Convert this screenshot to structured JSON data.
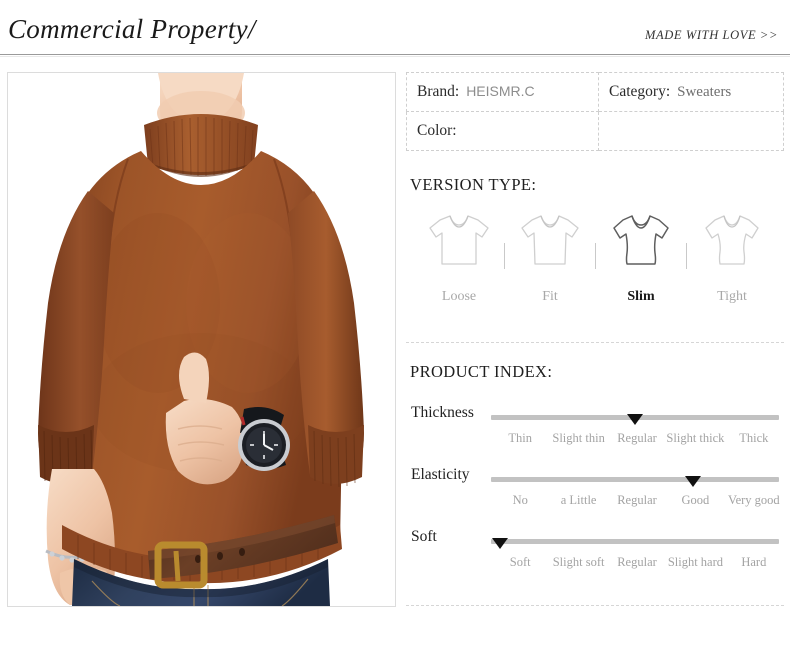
{
  "header": {
    "title": "Commercial Property/",
    "tagline": "MADE WITH LOVE >>"
  },
  "product_image": {
    "alt": "Man wearing brown rust turtleneck sweater with leather belt and blue jeans",
    "sweater_color": "#a0522d",
    "jeans_color": "#2c3e55",
    "belt_color": "#5e3a28",
    "skin_color": "#f3cdb3"
  },
  "attributes": {
    "rows": [
      [
        {
          "key": "Brand:",
          "value": "HEISMR.C",
          "value_style": "sans"
        },
        {
          "key": "Category:",
          "value": "Sweaters",
          "value_style": "serif"
        }
      ],
      [
        {
          "key": "Color:",
          "value": "",
          "value_style": "serif"
        },
        {
          "key": "",
          "value": "",
          "value_style": "serif"
        }
      ]
    ]
  },
  "version_type": {
    "heading": "VERSION TYPE:",
    "options": [
      {
        "label": "Loose",
        "icon": "tee-loose-icon",
        "selected": false
      },
      {
        "label": "Fit",
        "icon": "tee-fit-icon",
        "selected": false
      },
      {
        "label": "Slim",
        "icon": "tee-slim-icon",
        "selected": true
      },
      {
        "label": "Tight",
        "icon": "tee-tight-icon",
        "selected": false
      }
    ]
  },
  "product_index": {
    "heading": "PRODUCT INDEX:",
    "sliders": [
      {
        "name": "Thickness",
        "scale": [
          "Thin",
          "Slight thin",
          "Regular",
          "Slight thick",
          "Thick"
        ],
        "selected_index": 2,
        "selected_value": "Regular",
        "marker_percent": 50
      },
      {
        "name": "Elasticity",
        "scale": [
          "No",
          "a Little",
          "Regular",
          "Good",
          "Very good"
        ],
        "selected_index": 3,
        "selected_value": "Good",
        "marker_percent": 70
      },
      {
        "name": "Soft",
        "scale": [
          "Soft",
          "Slight soft",
          "Regular",
          "Slight hard",
          "Hard"
        ],
        "selected_index": 0,
        "selected_value": "Soft",
        "marker_percent": 3
      }
    ]
  },
  "colors": {
    "heading_text": "#1f1f1f",
    "muted_text": "#a3a3a3",
    "track": "#c2c2c2",
    "marker": "#111111",
    "border_dashed": "#cfcfcf"
  }
}
